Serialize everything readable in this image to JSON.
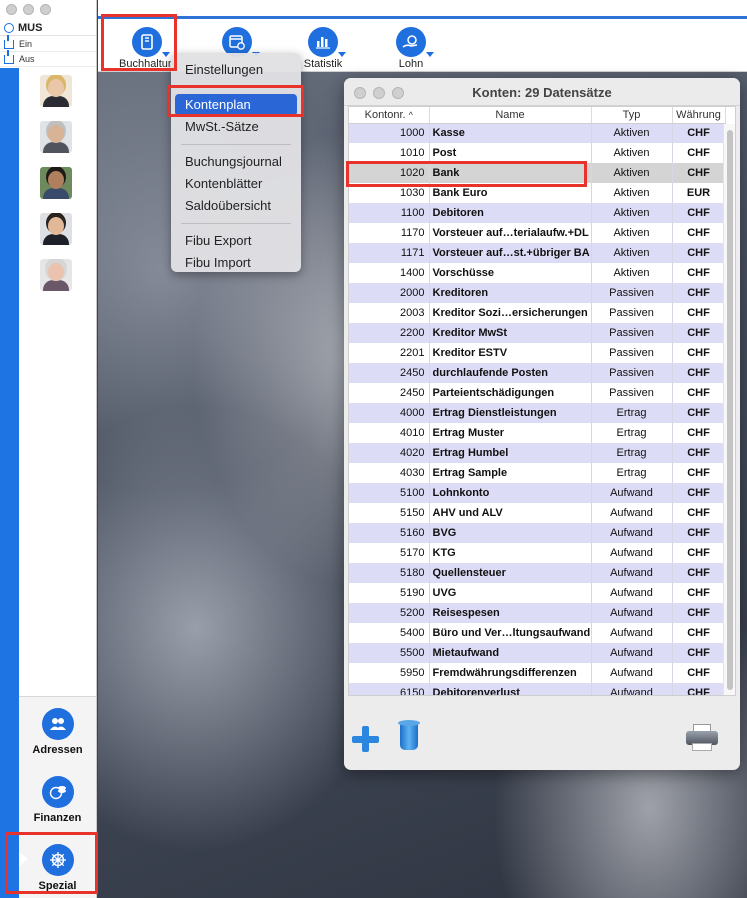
{
  "sidebar": {
    "title": "MUS",
    "in_label": "Ein",
    "out_label": "Aus",
    "nav": [
      {
        "label": "Adressen",
        "icon": "people-icon"
      },
      {
        "label": "Finanzen",
        "icon": "coins-icon"
      },
      {
        "label": "Spezial",
        "icon": "wheel-icon"
      }
    ]
  },
  "toolbar": {
    "buttons": [
      {
        "label": "Buchhaltung",
        "icon": "book-icon"
      },
      {
        "label": "",
        "icon": "calendar-clock-icon"
      },
      {
        "label": "Statistik",
        "icon": "bar-chart-icon"
      },
      {
        "label": "Lohn",
        "icon": "hand-coin-icon"
      }
    ]
  },
  "menu": {
    "items": [
      "Einstellungen",
      "Kontenplan",
      "MwSt.-Sätze",
      "Buchungsjournal",
      "Kontenblätter",
      "Saldoübersicht",
      "Fibu Export",
      "Fibu Import"
    ],
    "selected": "Kontenplan"
  },
  "konten": {
    "title": "Konten: 29 Datensätze",
    "columns": [
      "Kontonr.",
      "Name",
      "Typ",
      "Währung"
    ],
    "rows": [
      [
        "1000",
        "Kasse",
        "Aktiven",
        "CHF"
      ],
      [
        "1010",
        "Post",
        "Aktiven",
        "CHF"
      ],
      [
        "1020",
        "Bank",
        "Aktiven",
        "CHF"
      ],
      [
        "1030",
        "Bank Euro",
        "Aktiven",
        "EUR"
      ],
      [
        "1100",
        "Debitoren",
        "Aktiven",
        "CHF"
      ],
      [
        "1170",
        "Vorsteuer auf…terialaufw.+DL",
        "Aktiven",
        "CHF"
      ],
      [
        "1171",
        "Vorsteuer auf…st.+übriger BA",
        "Aktiven",
        "CHF"
      ],
      [
        "1400",
        "Vorschüsse",
        "Aktiven",
        "CHF"
      ],
      [
        "2000",
        "Kreditoren",
        "Passiven",
        "CHF"
      ],
      [
        "2003",
        "Kreditor Sozi…ersicherungen",
        "Passiven",
        "CHF"
      ],
      [
        "2200",
        "Kreditor MwSt",
        "Passiven",
        "CHF"
      ],
      [
        "2201",
        "Kreditor ESTV",
        "Passiven",
        "CHF"
      ],
      [
        "2450",
        "durchlaufende Posten",
        "Passiven",
        "CHF"
      ],
      [
        "2450",
        "Parteientschädigungen",
        "Passiven",
        "CHF"
      ],
      [
        "4000",
        "Ertrag Dienstleistungen",
        "Ertrag",
        "CHF"
      ],
      [
        "4010",
        "Ertrag Muster",
        "Ertrag",
        "CHF"
      ],
      [
        "4020",
        "Ertrag Humbel",
        "Ertrag",
        "CHF"
      ],
      [
        "4030",
        "Ertrag Sample",
        "Ertrag",
        "CHF"
      ],
      [
        "5100",
        "Lohnkonto",
        "Aufwand",
        "CHF"
      ],
      [
        "5150",
        "AHV und ALV",
        "Aufwand",
        "CHF"
      ],
      [
        "5160",
        "BVG",
        "Aufwand",
        "CHF"
      ],
      [
        "5170",
        "KTG",
        "Aufwand",
        "CHF"
      ],
      [
        "5180",
        "Quellensteuer",
        "Aufwand",
        "CHF"
      ],
      [
        "5190",
        "UVG",
        "Aufwand",
        "CHF"
      ],
      [
        "5200",
        "Reisespesen",
        "Aufwand",
        "CHF"
      ],
      [
        "5400",
        "Büro und Ver…ltungsaufwand",
        "Aufwand",
        "CHF"
      ],
      [
        "5500",
        "Mietaufwand",
        "Aufwand",
        "CHF"
      ],
      [
        "5950",
        "Fremdwährungsdifferenzen",
        "Aufwand",
        "CHF"
      ],
      [
        "6150",
        "Debitorenverlust",
        "Aufwand",
        "CHF"
      ]
    ],
    "selected_row": 2
  },
  "colors": {
    "accent": "#1f74e3",
    "highlight": "#e8322c",
    "row_alt": "#dcdcf6",
    "menu_selected": "#2a66d6"
  }
}
